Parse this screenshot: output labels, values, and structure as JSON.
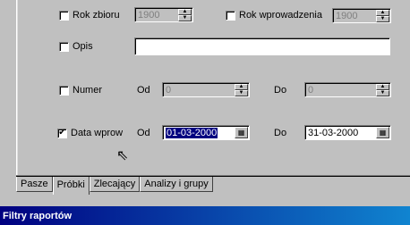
{
  "rows": {
    "rok_zbioru": {
      "label": "Rok zbioru",
      "checked": false,
      "value": "1900"
    },
    "rok_wprowadzenia": {
      "label": "Rok wprowadzenia",
      "checked": false,
      "value": "1900"
    },
    "opis": {
      "label": "Opis",
      "checked": false,
      "value": ""
    },
    "numer": {
      "label": "Numer",
      "checked": false,
      "od_label": "Od",
      "od_value": "0",
      "do_label": "Do",
      "do_value": "0"
    },
    "data_wprow": {
      "label": "Data wprow",
      "checked": true,
      "check_mark": "✔",
      "od_label": "Od",
      "od_value": "01-03-2000",
      "do_label": "Do",
      "do_value": "31-03-2000"
    }
  },
  "icons": {
    "spin_up": "▲",
    "spin_down": "▼",
    "calendar": "▦",
    "cursor": "⇖"
  },
  "tabs": [
    {
      "label": "Pasze",
      "active": false
    },
    {
      "label": "Próbki",
      "active": true
    },
    {
      "label": "Zlecający",
      "active": false
    },
    {
      "label": "Analizy i grupy",
      "active": false
    }
  ],
  "status_title": "Filtry raportów"
}
